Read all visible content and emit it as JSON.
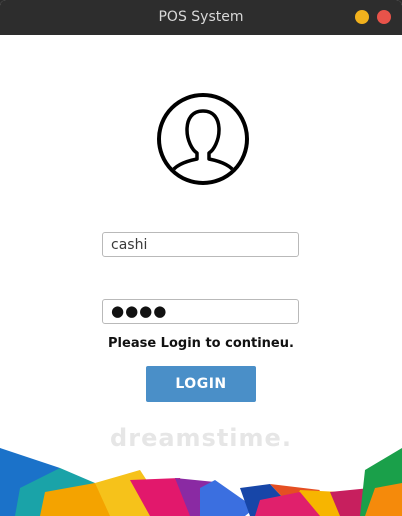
{
  "window": {
    "title": "POS System"
  },
  "login": {
    "username_value": "cashi",
    "password_masked": "●●●●",
    "message": "Please Login to contineu.",
    "button_label": "LOGIN"
  },
  "watermark": "dreamstime.",
  "colors": {
    "titlebar": "#2d2d2d",
    "minimize": "#f1b11d",
    "close": "#e8534a",
    "button": "#4a8fc8"
  },
  "icons": {
    "avatar": "user-silhouette-icon",
    "minimize": "minimize-icon",
    "close": "close-icon"
  }
}
